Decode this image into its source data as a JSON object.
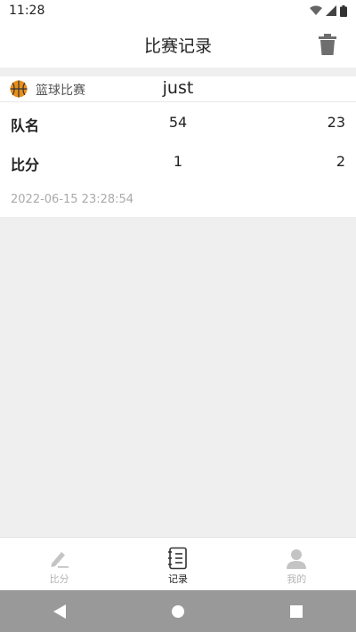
{
  "status_bar": {
    "time": "11:28"
  },
  "app_bar": {
    "title": "比赛记录"
  },
  "record": {
    "game_type": "篮球比赛",
    "match_name": "just",
    "rows": [
      {
        "label": "队名",
        "left": "54",
        "right": "23"
      },
      {
        "label": "比分",
        "left": "1",
        "right": "2"
      }
    ],
    "timestamp": "2022-06-15 23:28:54"
  },
  "bottom_nav": {
    "items": [
      {
        "label": "比分",
        "icon": "pencil-icon"
      },
      {
        "label": "记录",
        "icon": "notebook-icon"
      },
      {
        "label": "我的",
        "icon": "person-icon"
      }
    ],
    "active_index": 1
  },
  "colors": {
    "background": "#efefef",
    "surface": "#ffffff",
    "basketball": "#e8901c",
    "inactive": "#b5b5b5",
    "system_nav": "#999999"
  }
}
